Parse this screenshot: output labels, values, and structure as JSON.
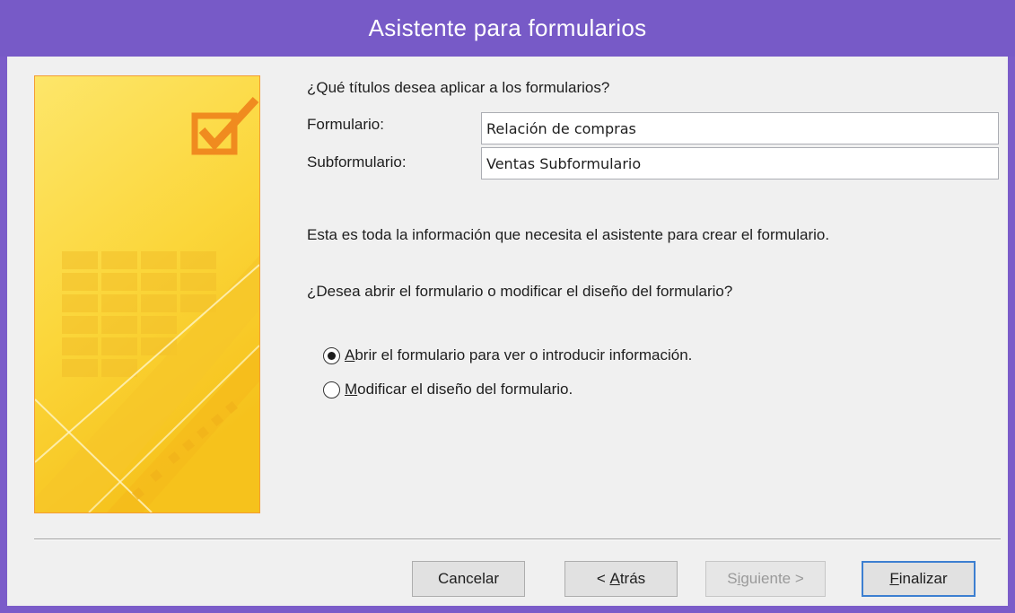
{
  "window": {
    "title": "Asistente para formularios"
  },
  "form": {
    "prompt": "¿Qué títulos desea aplicar a los formularios?",
    "form_label": "Formulario:",
    "form_value": "Relación de compras",
    "subform_label": "Subformulario:",
    "subform_value": "Ventas Subformulario"
  },
  "info_text": "Esta es toda la información que necesita el asistente para crear el formulario.",
  "question": "¿Desea abrir el formulario o modificar el diseño del formulario?",
  "options": [
    {
      "mnemonic": "A",
      "rest": "brir el formulario para ver o introducir información.",
      "checked": true
    },
    {
      "mnemonic": "M",
      "rest": "odificar el diseño del formulario.",
      "checked": false
    }
  ],
  "buttons": {
    "cancel": {
      "before": "Cancelar",
      "mnemonic": "",
      "after": ""
    },
    "back": {
      "before": "< ",
      "mnemonic": "A",
      "after": "trás"
    },
    "next": {
      "before": "S",
      "mnemonic": "i",
      "after": "guiente >"
    },
    "finish": {
      "before": "",
      "mnemonic": "F",
      "after": "inalizar"
    }
  },
  "colors": {
    "titlebar": "#775ac7",
    "dialog_bg": "#f0f0f0",
    "art_border": "#f49c33",
    "art_yellow": "#fbd63a"
  }
}
